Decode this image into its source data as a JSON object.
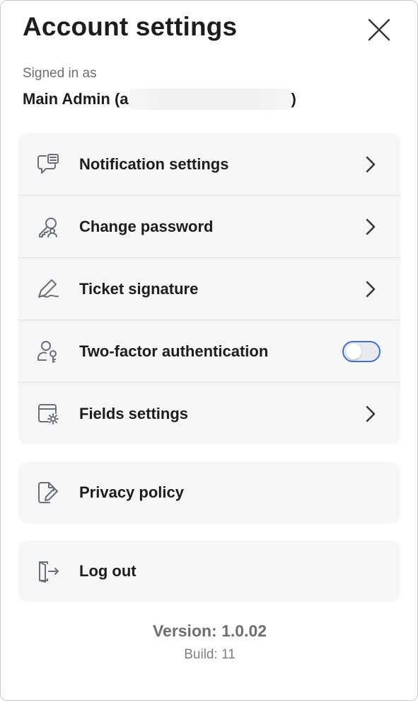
{
  "header": {
    "title": "Account settings",
    "close_icon": "close-icon"
  },
  "account": {
    "signed_in_label": "Signed in as",
    "name_prefix": "Main Admin (a",
    "name_suffix": ")"
  },
  "settings_menu": {
    "items": [
      {
        "label": "Notification settings",
        "icon": "notification-chat-icon"
      },
      {
        "label": "Change password",
        "icon": "key-user-icon"
      },
      {
        "label": "Ticket signature",
        "icon": "signature-icon"
      },
      {
        "label": "Two-factor authentication",
        "icon": "user-key-icon",
        "toggle_on": false
      },
      {
        "label": "Fields settings",
        "icon": "window-gear-icon"
      }
    ]
  },
  "privacy": {
    "label": "Privacy policy",
    "icon": "document-edit-icon"
  },
  "logout": {
    "label": "Log out",
    "icon": "logout-icon"
  },
  "footer": {
    "version": "Version: 1.0.02",
    "build": "Build: 11"
  },
  "colors": {
    "card_bg": "#f4f6f8",
    "toggle_border": "#3f6fd1",
    "icon_gray": "#6b6f73"
  }
}
